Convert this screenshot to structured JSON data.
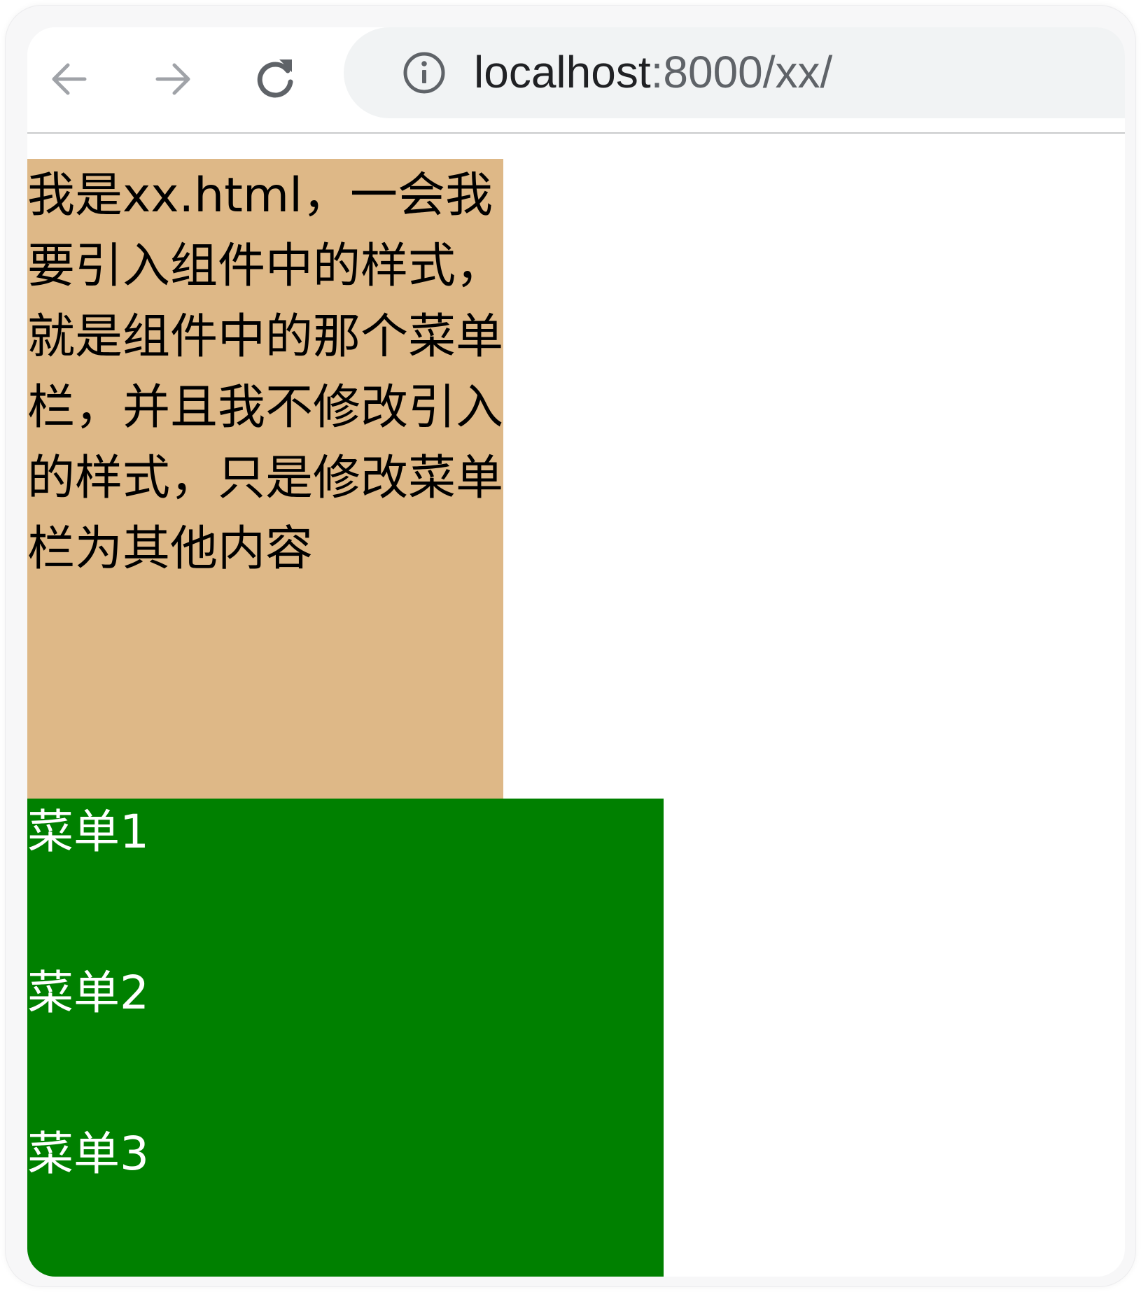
{
  "browser": {
    "url_host": "localhost",
    "url_rest": ":8000/xx/",
    "icons": {
      "back": "arrow-left-icon",
      "forward": "arrow-right-icon",
      "reload": "reload-icon",
      "site_info": "info-icon"
    },
    "colors": {
      "icon_disabled": "#a0a3a8",
      "icon_active": "#5f6368",
      "address_bar_bg": "#f1f3f4"
    }
  },
  "page": {
    "content_text": "我是xx.html，一会我要引入组件中的样式，就是组件中的那个菜单栏，并且我不修改引入的样式，只是修改菜单栏为其他内容",
    "content_bg": "#deb887",
    "menu_bg": "#008000",
    "menu_items": [
      {
        "label": "菜单1"
      },
      {
        "label": "菜单2"
      },
      {
        "label": "菜单3"
      }
    ]
  }
}
